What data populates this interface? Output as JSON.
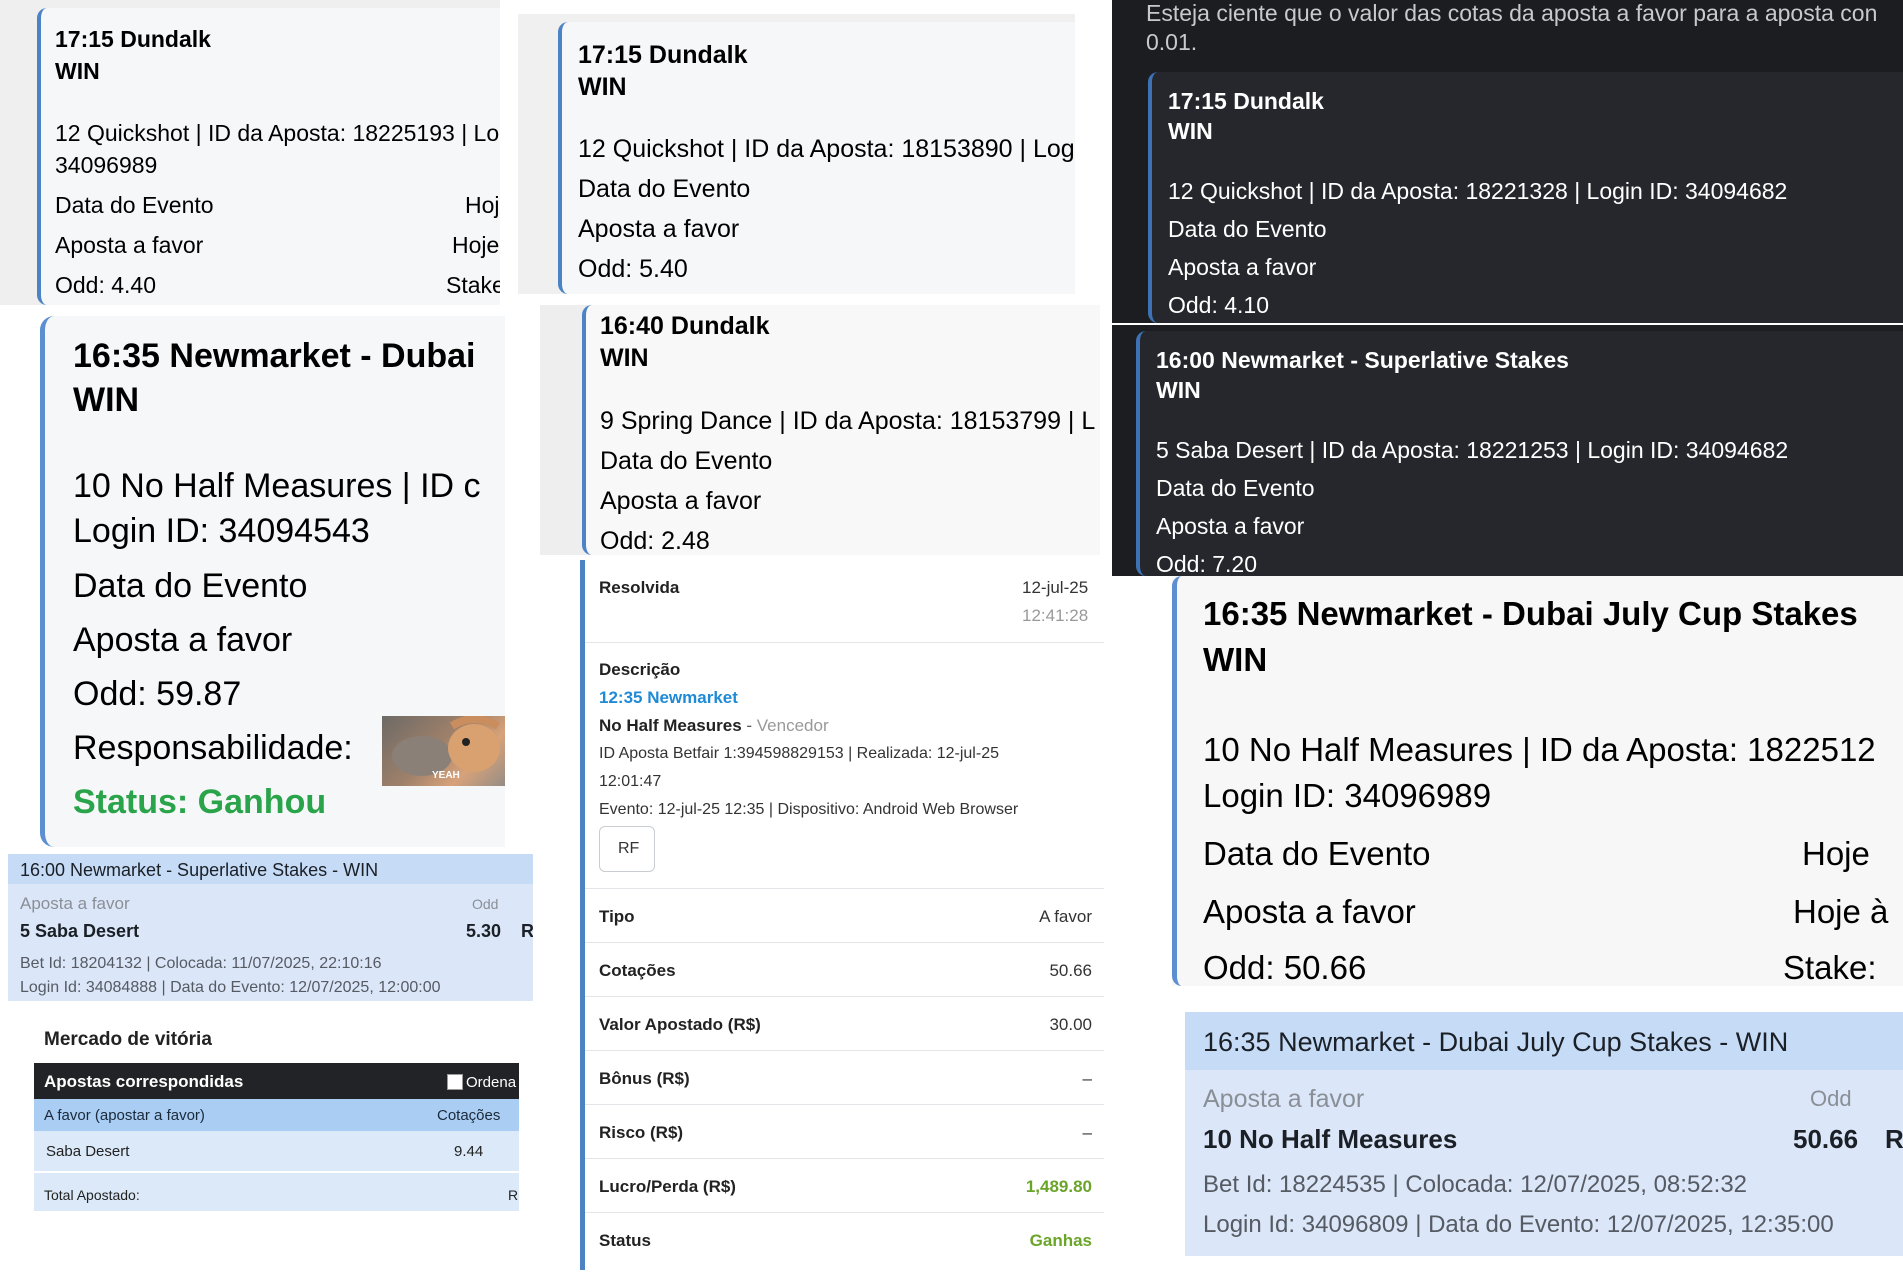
{
  "cards": {
    "c1": {
      "title": "17:15 Dundalk",
      "market": "WIN",
      "selection": "12 Quickshot | ID da Aposta: 18225193 | Log",
      "selection_cont": "34096989",
      "date_label": "Data do Evento",
      "date_value": "Hoj",
      "bet_label": "Aposta a favor",
      "bet_value": "Hoje",
      "odd": "Odd: 4.40",
      "stake": "Stake"
    },
    "c2": {
      "title": "17:15 Dundalk",
      "market": "WIN",
      "selection": "12 Quickshot | ID da Aposta: 18153890 | Log",
      "date_label": "Data do Evento",
      "bet_label": "Aposta a favor",
      "odd": "Odd: 5.40"
    },
    "c3": {
      "notice": "Esteja ciente que o valor das cotas da aposta a favor para a aposta con",
      "notice_cont": "0.01.",
      "title": "17:15 Dundalk",
      "market": "WIN",
      "selection": "12 Quickshot | ID da Aposta: 18221328 | Login ID: 34094682",
      "date_label": "Data do Evento",
      "bet_label": "Aposta a favor",
      "odd": "Odd: 4.10"
    },
    "c4": {
      "title": "16:35 Newmarket - Dubai",
      "market": "WIN",
      "selection": "10 No Half Measures | ID c",
      "login": "Login ID: 34094543",
      "date_label": "Data do Evento",
      "bet_label": "Aposta a favor",
      "odd": "Odd: 59.87",
      "liability": "Responsabilidade:",
      "meme_text": "YEAH",
      "status": "Status: Ganhou"
    },
    "c5": {
      "title": "16:40 Dundalk",
      "market": "WIN",
      "selection": "9 Spring Dance | ID da Aposta: 18153799 | L",
      "date_label": "Data do Evento",
      "bet_label": "Aposta a favor",
      "odd": "Odd: 2.48"
    },
    "c6": {
      "title": "16:00 Newmarket - Superlative Stakes",
      "market": "WIN",
      "selection": "5 Saba Desert | ID da Aposta: 18221253 | Login ID: 34094682",
      "date_label": "Data do Evento",
      "bet_label": "Aposta a favor",
      "odd": "Odd: 7.20"
    },
    "c7": {
      "header": "16:00 Newmarket - Superlative Stakes - WIN",
      "bet_label": "Aposta a favor",
      "odd_label": "Odd",
      "selection": "5 Saba Desert",
      "odd": "5.30",
      "trail": "R",
      "bet_id": "Bet Id: 18204132 | Colocada: 11/07/2025, 22:10:16",
      "login": "Login Id: 34084888 | Data do Evento: 12/07/2025, 12:00:00"
    },
    "c8": {
      "title": "Mercado de vitória",
      "bar_label": "Apostas correspondidas",
      "ordena": "Ordena",
      "col1": "A favor (apostar a favor)",
      "col2": "Cotações",
      "runner": "Saba Desert",
      "price": "9.44",
      "total": "Total Apostado:",
      "total_trail": "R"
    },
    "c9": {
      "resolved_label": "Resolvida",
      "resolved_date": "12-jul-25",
      "resolved_time": "12:41:28",
      "desc_label": "Descrição",
      "race": "12:35 Newmarket",
      "runner": "No Half Measures",
      "runner_sep": " - ",
      "winner": "Vencedor",
      "betfair": "ID Aposta Betfair 1:394598829153 | Realizada: 12-jul-25",
      "betfair_cont": "12:01:47",
      "event": "Evento: 12-jul-25 12:35 | Dispositivo: Android Web Browser",
      "rf": "RF",
      "rows": [
        {
          "k": "Tipo",
          "v": "A favor"
        },
        {
          "k": "Cotações",
          "v": "50.66"
        },
        {
          "k": "Valor Apostado (R$)",
          "v": "30.00"
        },
        {
          "k": "Bônus (R$)",
          "v": "–"
        },
        {
          "k": "Risco (R$)",
          "v": "–"
        },
        {
          "k": "Lucro/Perda (R$)",
          "v": "1,489.80"
        },
        {
          "k": "Status",
          "v": "Ganhas"
        }
      ]
    },
    "c10": {
      "title": "16:35 Newmarket - Dubai July Cup Stakes",
      "market": "WIN",
      "selection": "10 No Half Measures | ID da Aposta: 1822512",
      "login": "Login ID: 34096989",
      "date_label": "Data do Evento",
      "date_value": "Hoje",
      "bet_label": "Aposta a favor",
      "bet_value": "Hoje à",
      "odd": "Odd: 50.66",
      "stake": "Stake:"
    },
    "c11": {
      "header": "16:35 Newmarket - Dubai July Cup Stakes - WIN",
      "bet_label": "Aposta a favor",
      "odd_label": "Odd",
      "selection": "10 No Half Measures",
      "odd": "50.66",
      "trail": "R",
      "bet_id": "Bet Id: 18224535 | Colocada: 12/07/2025, 08:52:32",
      "login": "Login Id: 34096809 | Data do Evento: 12/07/2025, 12:35:00"
    }
  },
  "colors": {
    "win_green": "#2aa44a",
    "accent_blue": "#4b83c4",
    "dark_bg": "#1c1d21",
    "light_blue": "#dbe7f8"
  },
  "icons": {
    "meme": "horse-meme-image",
    "checkbox": "checkbox-icon"
  }
}
